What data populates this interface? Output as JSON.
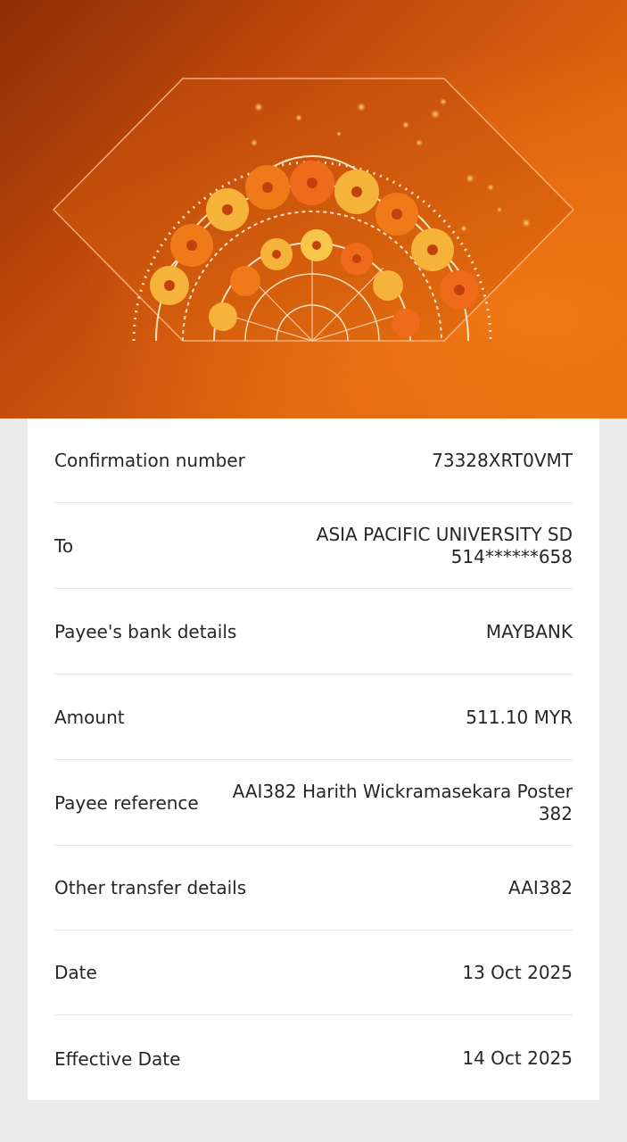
{
  "banner": {
    "image": "diwali-mandala-marigold-banner",
    "colors": {
      "background_dark": "#8f2e06",
      "background_light": "#e6700f",
      "ornament": "#fbe3c0",
      "marigold_orange": "#f07a1a",
      "marigold_yellow": "#f6b33a"
    }
  },
  "details": {
    "rows": [
      {
        "label": "Confirmation number",
        "value_lines": [
          "73328XRT0VMT"
        ]
      },
      {
        "label": "To",
        "value_lines": [
          "ASIA PACIFIC UNIVERSITY SD",
          "514******658"
        ]
      },
      {
        "label": "Payee's bank details",
        "value_lines": [
          "MAYBANK"
        ]
      },
      {
        "label": "Amount",
        "value_lines": [
          "511.10 MYR"
        ]
      },
      {
        "label": "Payee reference",
        "value_lines": [
          "AAI382 Harith Wickramasekara Poster",
          "382"
        ]
      },
      {
        "label": "Other transfer details",
        "value_lines": [
          "AAI382"
        ]
      },
      {
        "label": "Date",
        "value_lines": [
          "13 Oct 2025"
        ]
      },
      {
        "label": "Effective Date",
        "value_lines": [
          "14 Oct 2025"
        ]
      }
    ]
  }
}
